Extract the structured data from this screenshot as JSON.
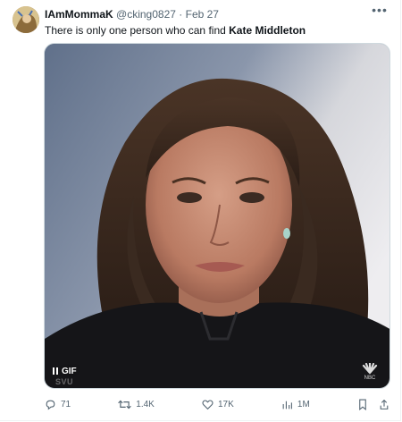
{
  "tweet": {
    "display_name": "IAmMommaK",
    "handle": "@cking0827",
    "separator": "·",
    "date": "Feb 27",
    "text_prefix": "There is only one person who can find ",
    "text_bold": "Kate Middleton",
    "more_icon": "more-horizontal-icon"
  },
  "media": {
    "badge_label": "GIF",
    "watermark": "SVU",
    "network_logo": "NBC"
  },
  "actions": {
    "replies": "71",
    "reposts": "1.4K",
    "likes": "17K",
    "views": "1M"
  },
  "colors": {
    "text": "#0f1419",
    "secondary": "#536471",
    "border": "#cfd9de"
  }
}
